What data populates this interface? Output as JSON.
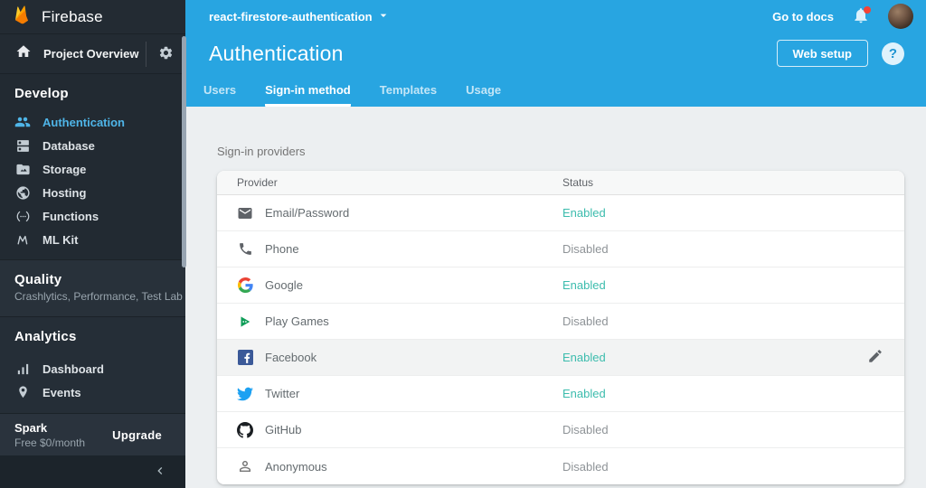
{
  "sidebar": {
    "brand": "Firebase",
    "project_overview": "Project Overview",
    "develop": {
      "title": "Develop",
      "items": [
        "Authentication",
        "Database",
        "Storage",
        "Hosting",
        "Functions",
        "ML Kit"
      ]
    },
    "quality": {
      "title": "Quality",
      "subtitle": "Crashlytics, Performance, Test Lab"
    },
    "analytics": {
      "title": "Analytics",
      "items": [
        "Dashboard",
        "Events"
      ]
    },
    "plan": {
      "name": "Spark",
      "detail": "Free $0/month",
      "action": "Upgrade"
    }
  },
  "topbar": {
    "project": "react-firestore-authentication",
    "go_to_docs": "Go to docs"
  },
  "header": {
    "title": "Authentication",
    "web_setup": "Web setup"
  },
  "tabs": [
    {
      "label": "Users",
      "active": false
    },
    {
      "label": "Sign-in method",
      "active": true
    },
    {
      "label": "Templates",
      "active": false
    },
    {
      "label": "Usage",
      "active": false
    }
  ],
  "main": {
    "section_label": "Sign-in providers",
    "table": {
      "columns": [
        "Provider",
        "Status"
      ],
      "rows": [
        {
          "provider": "Email/Password",
          "icon": "email-icon",
          "status": "Enabled",
          "highlighted": false
        },
        {
          "provider": "Phone",
          "icon": "phone-icon",
          "status": "Disabled",
          "highlighted": false
        },
        {
          "provider": "Google",
          "icon": "google-icon",
          "status": "Enabled",
          "highlighted": false
        },
        {
          "provider": "Play Games",
          "icon": "play-games-icon",
          "status": "Disabled",
          "highlighted": false
        },
        {
          "provider": "Facebook",
          "icon": "facebook-icon",
          "status": "Enabled",
          "highlighted": true,
          "action": "edit"
        },
        {
          "provider": "Twitter",
          "icon": "twitter-icon",
          "status": "Enabled",
          "highlighted": false
        },
        {
          "provider": "GitHub",
          "icon": "github-icon",
          "status": "Disabled",
          "highlighted": false
        },
        {
          "provider": "Anonymous",
          "icon": "anonymous-icon",
          "status": "Disabled",
          "highlighted": false
        }
      ]
    }
  },
  "colors": {
    "header_blue": "#28A5E1",
    "sidebar_dark": "#222A32",
    "active_item_blue": "#4FB5E8",
    "enabled_teal": "#3CBCAD",
    "disabled_gray": "#8E9397",
    "content_bg": "#ECEFF1",
    "notification_red": "#F44336"
  }
}
